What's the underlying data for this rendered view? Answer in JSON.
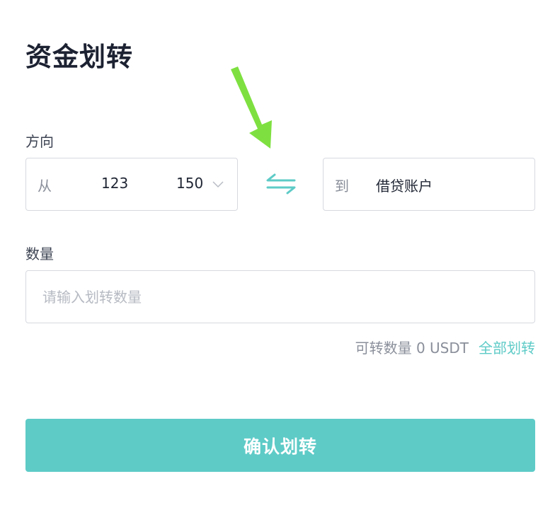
{
  "page": {
    "title": "资金划转"
  },
  "direction": {
    "label": "方向",
    "from": {
      "prefix": "从",
      "account_part1": "123",
      "account_part2": "150"
    },
    "to": {
      "prefix": "到",
      "account": "借贷账户"
    }
  },
  "amount": {
    "label": "数量",
    "placeholder": "请输入划转数量",
    "available_text": "可转数量 0 USDT",
    "transfer_all": "全部划转"
  },
  "confirm_button": "确认划转",
  "colors": {
    "accent": "#5ecbc7",
    "annotation_arrow": "#7ee040"
  },
  "icons": {
    "swap": "swap-arrows-icon",
    "dropdown": "chevron-down-icon",
    "annotation": "green-arrow-icon"
  }
}
